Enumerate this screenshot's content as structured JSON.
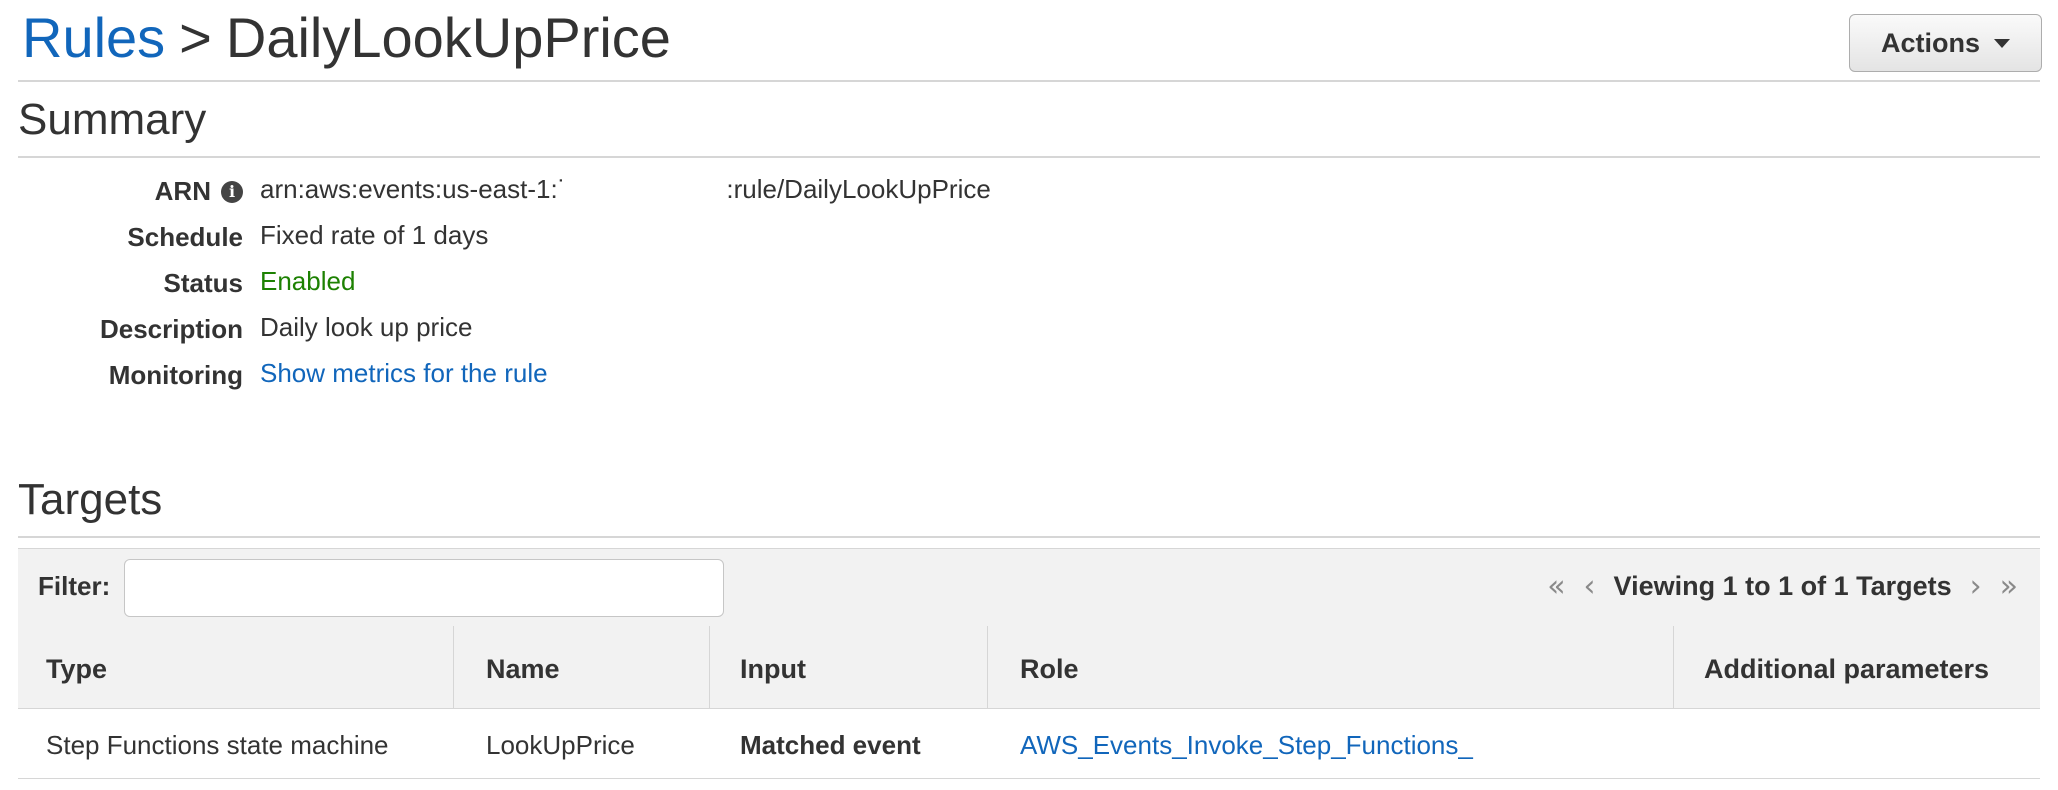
{
  "breadcrumb": {
    "parent": "Rules",
    "separator": ">",
    "current": "DailyLookUpPrice"
  },
  "actions_label": "Actions",
  "summary": {
    "title": "Summary",
    "rows": {
      "arn": {
        "label": "ARN",
        "value_prefix": "arn:aws:events:us-east-1:˙",
        "value_suffix": ":rule/DailyLookUpPrice"
      },
      "schedule": {
        "label": "Schedule",
        "value": "Fixed rate of 1 days"
      },
      "status": {
        "label": "Status",
        "value": "Enabled"
      },
      "description": {
        "label": "Description",
        "value": "Daily look up price"
      },
      "monitoring": {
        "label": "Monitoring",
        "value": "Show metrics for the rule"
      }
    }
  },
  "targets": {
    "title": "Targets",
    "filter_label": "Filter:",
    "filter_value": "",
    "pager_text": "Viewing 1 to 1 of 1 Targets",
    "columns": [
      "Type",
      "Name",
      "Input",
      "Role",
      "Additional parameters"
    ],
    "rows": [
      {
        "type": "Step Functions state machine",
        "name": "LookUpPrice",
        "input": "Matched event",
        "role": "AWS_Events_Invoke_Step_Functions_",
        "additional": ""
      }
    ]
  },
  "colors": {
    "link": "#1166bb",
    "enabled": "#1d8102",
    "header_bg": "#f2f2f2"
  }
}
